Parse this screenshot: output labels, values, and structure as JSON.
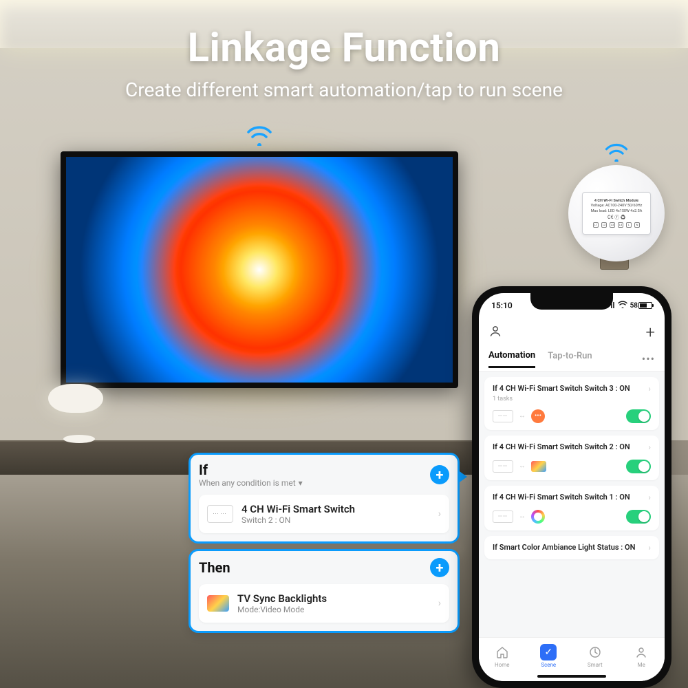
{
  "headline": {
    "title": "Linkage Function",
    "subtitle": "Create different smart automation/tap to run scene"
  },
  "module": {
    "name": "4 CH Wi-Fi Switch Module",
    "voltage": "Voltage: AC100-240V 50/60Hz",
    "maxload": "Max load: LED 4x150W 4x2.5A",
    "terminals": [
      "L1",
      "L2",
      "L3",
      "L4",
      "L",
      "N"
    ]
  },
  "callout": {
    "if_label": "If",
    "if_sub": "When any condition is met",
    "if_item": {
      "name": "4 CH Wi-Fi Smart Switch",
      "detail": "Switch 2 : ON"
    },
    "then_label": "Then",
    "then_item": {
      "name": "TV Sync Backlights",
      "detail": "Mode:Video Mode"
    }
  },
  "phone": {
    "status": {
      "time": "15:10",
      "battery": "58"
    },
    "tabs": {
      "left": "Automation",
      "right": "Tap-to-Run"
    },
    "automations": [
      {
        "title": "If 4 CH Wi-Fi Smart Switch  Switch 3 : ON",
        "tasks": "1 tasks",
        "target": "bubble-orange"
      },
      {
        "title": "If 4 CH Wi-Fi Smart Switch  Switch 2 : ON",
        "tasks": "",
        "target": "bubble-rainbow"
      },
      {
        "title": "If 4 CH Wi-Fi Smart Switch  Switch 1 : ON",
        "tasks": "",
        "target": "bubble-ring"
      },
      {
        "title": "If Smart Color Ambiance Light  Status : ON",
        "tasks": "",
        "target": ""
      }
    ],
    "nav": {
      "home": "Home",
      "scene": "Scene",
      "smart": "Smart",
      "me": "Me"
    }
  }
}
